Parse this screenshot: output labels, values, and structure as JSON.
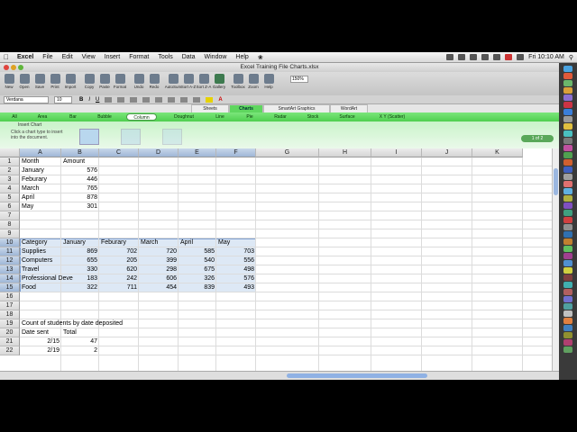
{
  "menubar": {
    "app_name": "Excel",
    "items": [
      "File",
      "Edit",
      "View",
      "Insert",
      "Format",
      "Tools",
      "Data",
      "Window",
      "Help"
    ],
    "clock": "Fri 10:10 AM",
    "status_icons": [
      "bluetooth-icon",
      "time-machine-icon",
      "sync-icon",
      "volume-icon",
      "wifi-icon",
      "flag-icon",
      "battery-icon"
    ]
  },
  "window": {
    "title": "Excel Training File Charts.xlsx"
  },
  "toolbar": {
    "buttons": [
      "New",
      "Open",
      "Save",
      "Print",
      "Import",
      "Copy",
      "Paste",
      "Format",
      "Undo",
      "Redo",
      "AutoSum",
      "Sort A-Z",
      "Sort Z-A",
      "Gallery",
      "Toolbox",
      "Zoom",
      "Help"
    ],
    "zoom_value": "150%"
  },
  "formatbar": {
    "font": "Verdana",
    "size": "10"
  },
  "ribbon": {
    "tabs": [
      "Sheets",
      "Charts",
      "SmartArt Graphics",
      "WordArt"
    ],
    "active_tab": "Charts",
    "chart_types": [
      "All",
      "Area",
      "Bar",
      "Bubble",
      "Column",
      "Doughnut",
      "Line",
      "Pie",
      "Radar",
      "Stock",
      "Surface",
      "X Y (Scatter)"
    ],
    "selected_chart_type": "Column",
    "insert_title": "Insert Chart",
    "insert_hint": "Click a chart type to insert into the document.",
    "pager": "1 of 2"
  },
  "grid": {
    "columns": [
      "A",
      "B",
      "C",
      "D",
      "E",
      "F",
      "G",
      "H",
      "I",
      "J",
      "K"
    ],
    "rows": [
      "1",
      "2",
      "3",
      "4",
      "5",
      "6",
      "7",
      "8",
      "9",
      "10",
      "11",
      "12",
      "13",
      "14",
      "15",
      "16",
      "17",
      "18",
      "19",
      "20",
      "21",
      "22"
    ],
    "section1": {
      "header": [
        "Month",
        "Amount"
      ],
      "rows": [
        [
          "January",
          "576"
        ],
        [
          "Feburary",
          "446"
        ],
        [
          "March",
          "765"
        ],
        [
          "April",
          "878"
        ],
        [
          "May",
          "301"
        ]
      ]
    },
    "section2": {
      "header": [
        "Category",
        "January",
        "Feburary",
        "March",
        "April",
        "May"
      ],
      "rows": [
        [
          "Supplies",
          "869",
          "702",
          "720",
          "585",
          "703"
        ],
        [
          "Computers",
          "655",
          "205",
          "399",
          "540",
          "556"
        ],
        [
          "Travel",
          "330",
          "620",
          "298",
          "675",
          "498"
        ],
        [
          "Professional Deve",
          "183",
          "242",
          "606",
          "326",
          "576"
        ],
        [
          "Food",
          "322",
          "711",
          "454",
          "839",
          "493"
        ]
      ]
    },
    "section3": {
      "title": "Count of students by date deposited",
      "header": [
        "Date sent",
        "Total"
      ],
      "rows": [
        [
          "2/15",
          "47"
        ],
        [
          "2/19",
          "2"
        ]
      ]
    }
  },
  "colors": {
    "ribbon_green": "#5fd65f",
    "selection": "#dde8f5"
  }
}
